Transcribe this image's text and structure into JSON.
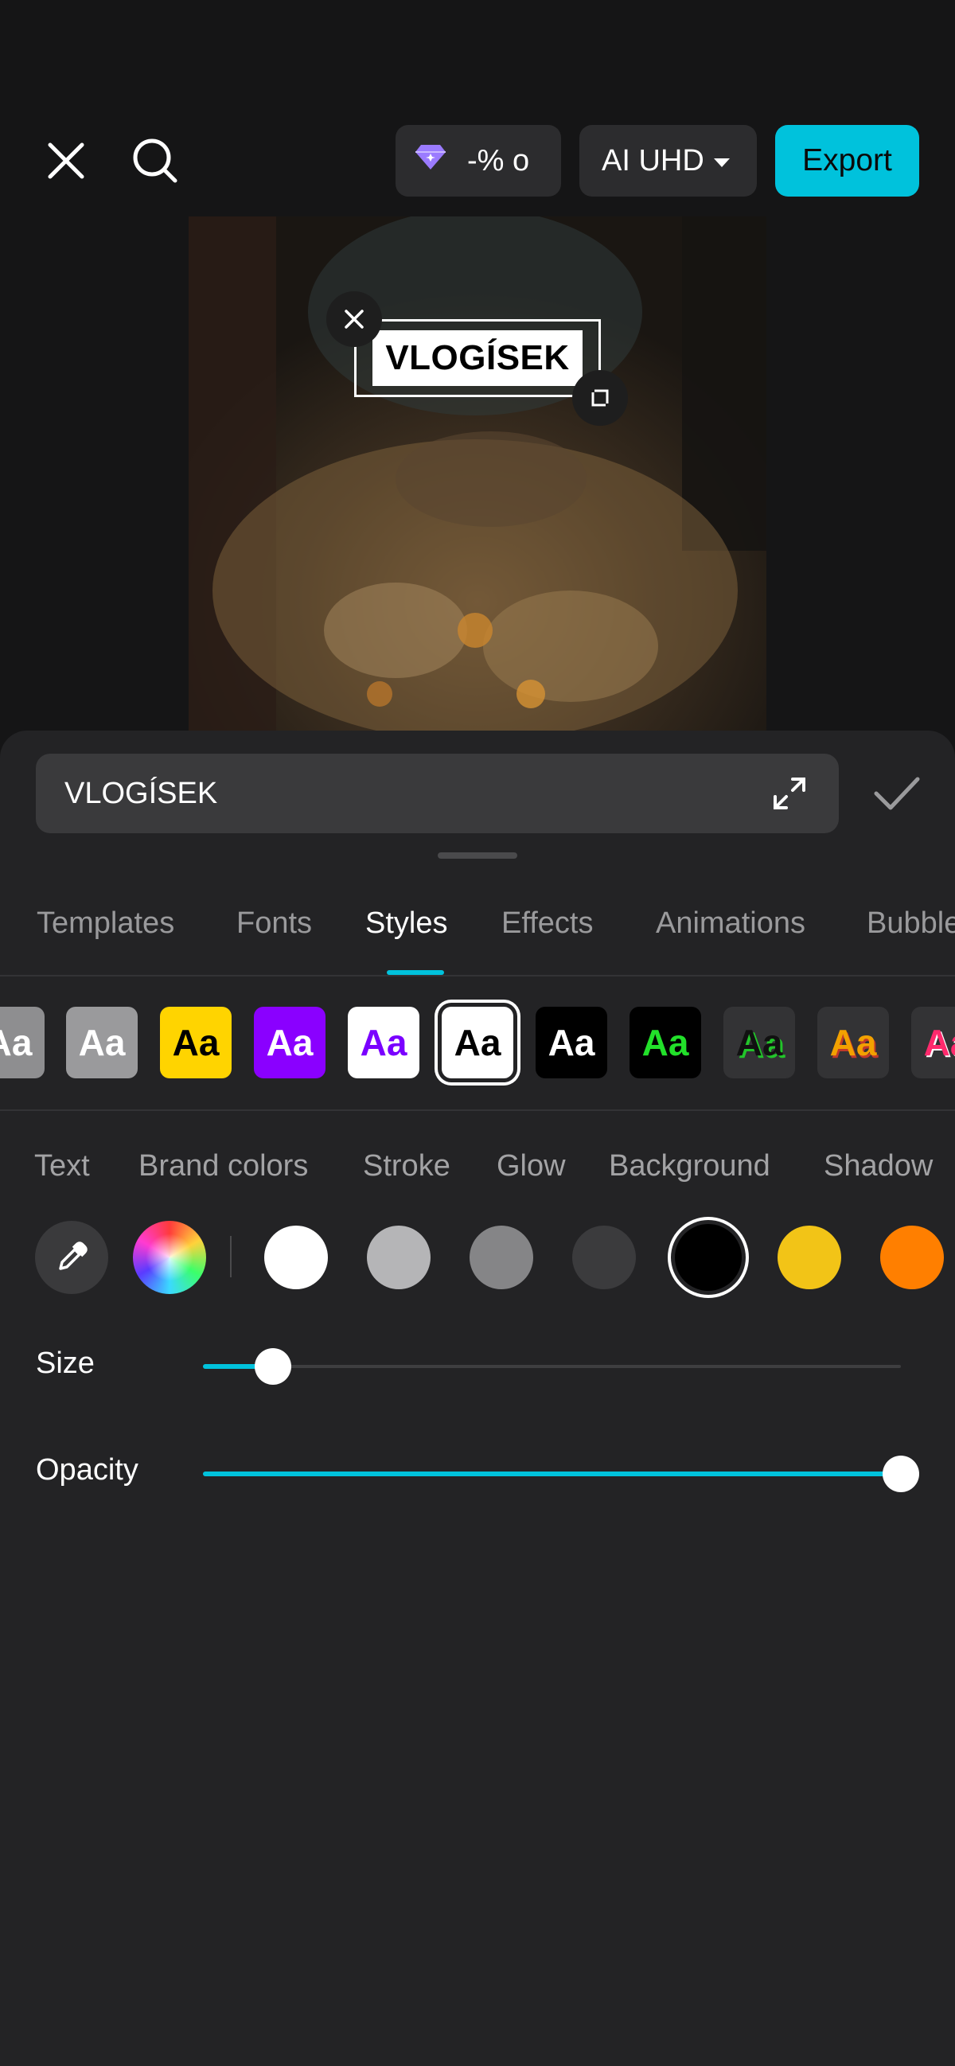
{
  "topbar": {
    "close_icon": "close-icon",
    "search_icon": "search-icon",
    "promo_text": "-% o",
    "promo_icon": "diamond-icon",
    "quality_label": "AI UHD",
    "export_label": "Export"
  },
  "preview": {
    "overlay_text": "VLOGÍSEK"
  },
  "editor": {
    "text_value": "VLOGÍSEK"
  },
  "tabs": [
    "Templates",
    "Fonts",
    "Styles",
    "Effects",
    "Animations",
    "Bubble"
  ],
  "active_tab": "Styles",
  "styles": {
    "swatch_label": "Aa",
    "swatches": [
      {
        "bg": "#8e8e90",
        "fg": "#ffffff"
      },
      {
        "bg": "#9a9a9c",
        "fg": "#ffffff"
      },
      {
        "bg": "#ffd400",
        "fg": "#000000"
      },
      {
        "bg": "#8a00ff",
        "fg": "#ffffff"
      },
      {
        "bg": "#ffffff",
        "fg": "#7a00ff"
      },
      {
        "bg": "#ffffff",
        "fg": "#000000",
        "selected": true
      },
      {
        "bg": "#000000",
        "fg": "#ffffff"
      },
      {
        "bg": "#000000",
        "fg": "#22e02a"
      },
      {
        "bg": "#333335",
        "fg": "#111111"
      },
      {
        "bg": "#333335",
        "fg": "#f2a100"
      },
      {
        "bg": "#333335",
        "fg": "#ff2a6d"
      }
    ]
  },
  "subtabs": [
    "Text",
    "Brand colors",
    "Stroke",
    "Glow",
    "Background",
    "Shadow"
  ],
  "colors": {
    "picker_icon": "eyedropper-icon",
    "wheel_icon": "color-wheel-icon",
    "swatches": [
      "#ffffff",
      "#b5b5b7",
      "#858587",
      "#3b3b3d",
      "#000000",
      "#f2c417",
      "#ff7f00"
    ],
    "selected_index": 4
  },
  "size": {
    "label": "Size",
    "value": 0.1
  },
  "opacity": {
    "label": "Opacity",
    "value": 1.0
  }
}
